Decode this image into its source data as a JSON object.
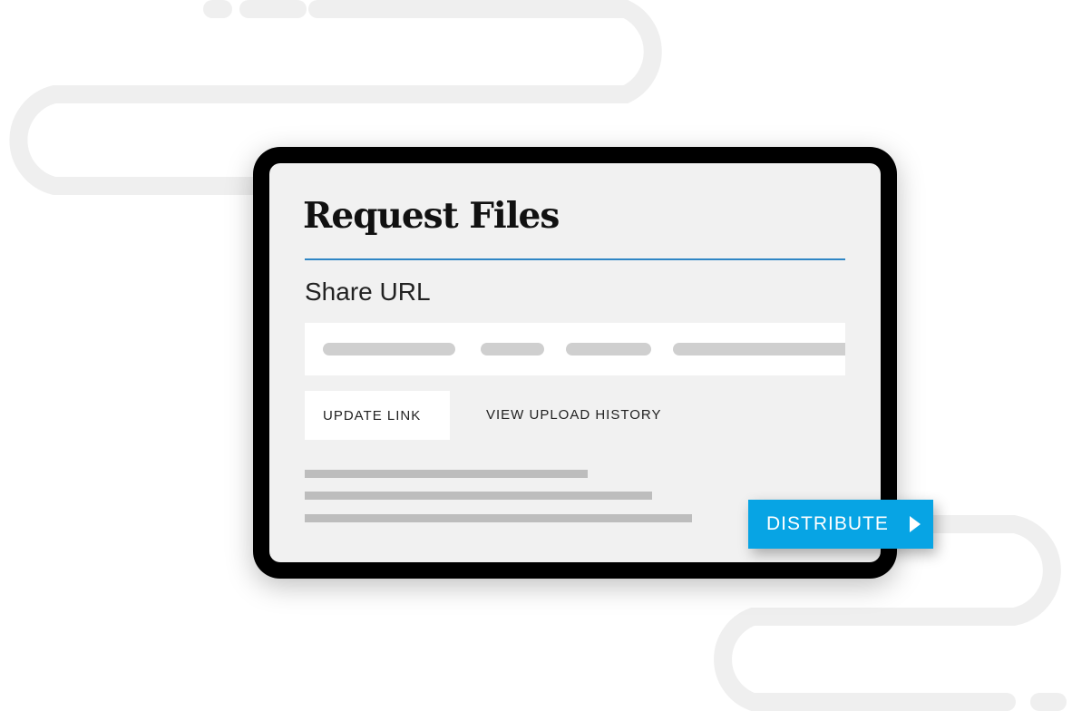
{
  "screen": {
    "title": "Request Files",
    "share_url_label": "Share URL",
    "update_link_label": "UPDATE LINK",
    "view_history_label": "VIEW UPLOAD HISTORY"
  },
  "distribute_button": {
    "label": "DISTRIBUTE",
    "icon": "play-arrow-icon"
  },
  "colors": {
    "accent_rule": "#2f86c5",
    "distribute_bg": "#07a4e4",
    "screen_bg": "#f1f1f1",
    "device_frame": "#000000",
    "decor_path": "#efefef"
  }
}
